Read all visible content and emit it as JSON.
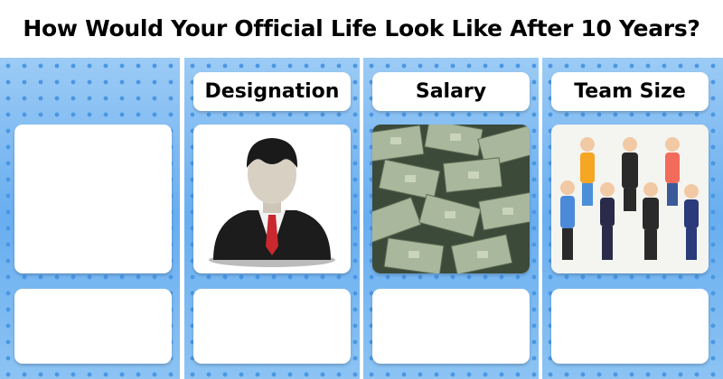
{
  "title": "How Would Your Official Life Look Like After 10 Years?",
  "columns": [
    {
      "label": "",
      "image": "blank"
    },
    {
      "label": "Designation",
      "image": "businessman-icon"
    },
    {
      "label": "Salary",
      "image": "money-stacks"
    },
    {
      "label": "Team Size",
      "image": "team-people"
    }
  ],
  "colors": {
    "background": "#6fb1ee",
    "dots": "#4a97e3",
    "card": "#ffffff"
  }
}
